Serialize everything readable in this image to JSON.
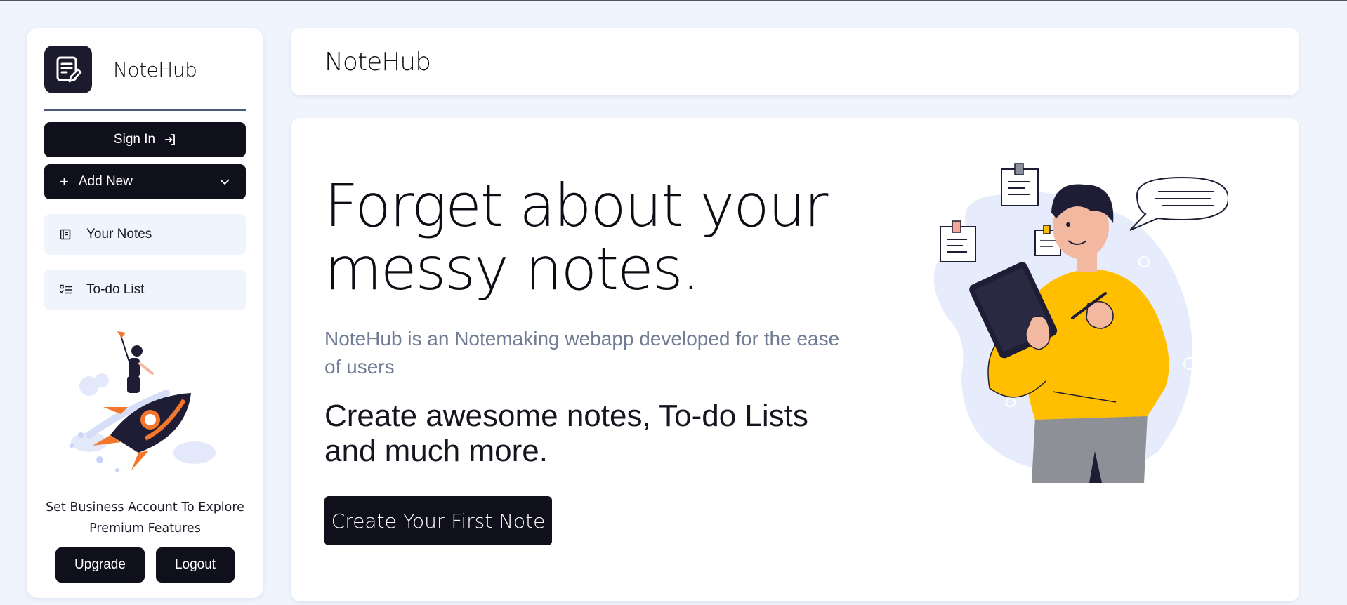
{
  "sidebar": {
    "brand_name": "NoteHub",
    "sign_in_label": "Sign In",
    "add_new_label": "Add New",
    "nav": [
      {
        "label": "Your Notes",
        "icon": "notebook-icon"
      },
      {
        "label": "To-do List",
        "icon": "checklist-icon"
      }
    ],
    "promo_text": "Set Business Account To Explore Premium Features",
    "upgrade_label": "Upgrade",
    "logout_label": "Logout"
  },
  "header": {
    "title": "NoteHub"
  },
  "hero": {
    "heading": "Forget about your messy notes.",
    "subtitle": "NoteHub is an Notemaking webapp developed for the ease of users",
    "tagline": "Create awesome notes, To-do Lists and much more.",
    "cta_label": "Create Your First Note"
  },
  "colors": {
    "page_background": "#f0f4fd",
    "dark_button": "#10101c",
    "nav_item_background": "#f0f4fd",
    "subtitle_text": "#6f7c93",
    "illustration_accent": "#ffbf00"
  }
}
